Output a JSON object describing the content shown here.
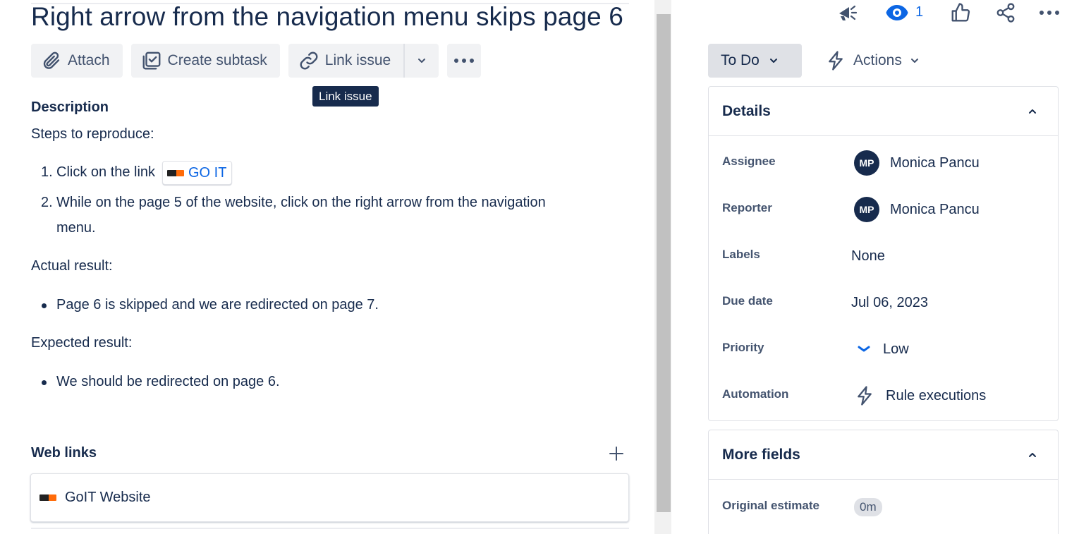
{
  "issue": {
    "title": "Right arrow from the navigation menu skips page 6"
  },
  "toolbar": {
    "attach_label": "Attach",
    "subtask_label": "Create subtask",
    "link_label": "Link issue"
  },
  "tooltip": {
    "text": "Link issue"
  },
  "description": {
    "heading": "Description",
    "steps_heading": "Steps to reproduce:",
    "steps": [
      {
        "num": "1.",
        "text": "Click on the link",
        "link_text": "GO IT"
      },
      {
        "num": "2.",
        "line1": "While on the page 5 of the website, click on the right arrow from the navigation",
        "line2": "menu."
      }
    ],
    "actual_heading": "Actual result:",
    "actual_items": [
      "Page 6 is skipped and we are redirected on page 7."
    ],
    "expected_heading": "Expected result:",
    "expected_items": [
      "We should be redirected on page 6."
    ]
  },
  "web_links": {
    "heading": "Web links",
    "items": [
      {
        "title": "GoIT Website"
      }
    ]
  },
  "header_actions": {
    "watch_count": "1"
  },
  "status": {
    "label": "To Do"
  },
  "actions": {
    "label": "Actions"
  },
  "details": {
    "heading": "Details",
    "assignee_label": "Assignee",
    "assignee_initials": "MP",
    "assignee_name": "Monica Pancu",
    "reporter_label": "Reporter",
    "reporter_initials": "MP",
    "reporter_name": "Monica Pancu",
    "labels_label": "Labels",
    "labels_value": "None",
    "due_label": "Due date",
    "due_value": "Jul 06, 2023",
    "priority_label": "Priority",
    "priority_value": "Low",
    "automation_label": "Automation",
    "automation_value": "Rule executions"
  },
  "more_fields": {
    "heading": "More fields",
    "estimate_label": "Original estimate",
    "estimate_value": "0m"
  },
  "colors": {
    "text": "#172b4d",
    "link": "#0c66e4",
    "button_bg": "#f1f2f4",
    "status_bg": "#dfe1e6",
    "avatar": "#172b4d",
    "priority_low": "#0c66e4"
  }
}
